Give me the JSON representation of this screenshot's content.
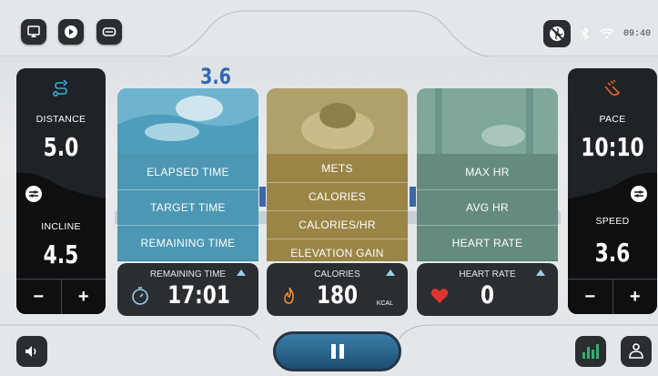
{
  "status": {
    "time": "09:40"
  },
  "left_panel": {
    "distance_label": "DISTANCE",
    "distance_value": "5.0",
    "incline_label": "INCLINE",
    "incline_value": "4.5",
    "minus": "−",
    "plus": "+"
  },
  "right_panel": {
    "pace_label": "PACE",
    "pace_value": "10:10",
    "speed_label": "SPEED",
    "speed_value": "3.6",
    "minus": "−",
    "plus": "+"
  },
  "floating_speed": "3.6",
  "cards": {
    "time": {
      "options": [
        "ELAPSED TIME",
        "TARGET TIME",
        "REMAINING TIME"
      ]
    },
    "calories": {
      "options": [
        "METS",
        "CALORIES",
        "CALORIES/HR",
        "ELEVATION GAIN"
      ]
    },
    "heart": {
      "options": [
        "MAX HR",
        "AVG HR",
        "HEART RATE"
      ]
    }
  },
  "readouts": {
    "time": {
      "label": "REMAINING TIME",
      "value": "17:01"
    },
    "calories": {
      "label": "CALORIES",
      "value": "180",
      "unit": "KCAL"
    },
    "heart": {
      "label": "HEART RATE",
      "value": "0"
    }
  },
  "colors": {
    "time_card": "#4c97b3",
    "calories_card": "#9a8546",
    "heart_card": "#648b7e",
    "pause_button": "#2f6a92"
  },
  "icons": {
    "top_left": [
      "screen-cast-icon",
      "media-icon",
      "tv-icon"
    ],
    "status": [
      "no-fan-icon",
      "bluetooth-icon",
      "wifi-icon"
    ],
    "bottom_left": "volume-icon",
    "bottom_right": [
      "stats-icon",
      "profile-icon"
    ]
  }
}
